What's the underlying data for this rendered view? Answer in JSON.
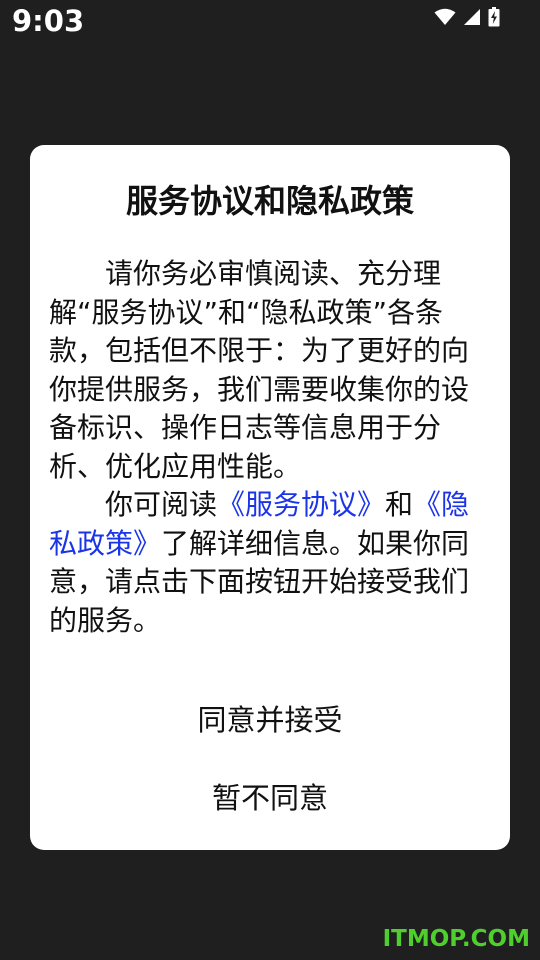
{
  "status_bar": {
    "time": "9:03",
    "icons": [
      "wifi-icon",
      "cellular-signal-icon",
      "battery-charging-icon"
    ]
  },
  "dialog": {
    "title": "服务协议和隐私政策",
    "paragraph1": "请你务必审慎阅读、充分理解“服务协议”和“隐私政策”各条款，包括但不限于：为了更好的向你提供服务，我们需要收集你的设备标识、操作日志等信息用于分析、优化应用性能。",
    "paragraph2_prefix": "你可阅读",
    "link_service": "《服务协议》",
    "paragraph2_and": "和",
    "link_privacy": "《隐私政策》",
    "paragraph2_suffix": "了解详细信息。如果你同意，请点击下面按钮开始接受我们的服务。",
    "agree_label": "同意并接受",
    "disagree_label": "暂不同意"
  },
  "watermark": "ITMOP.COM",
  "colors": {
    "background": "#1f1f1f",
    "dialog": "#ffffff",
    "link": "#1a35e8",
    "watermark": "#4fcf2e"
  }
}
